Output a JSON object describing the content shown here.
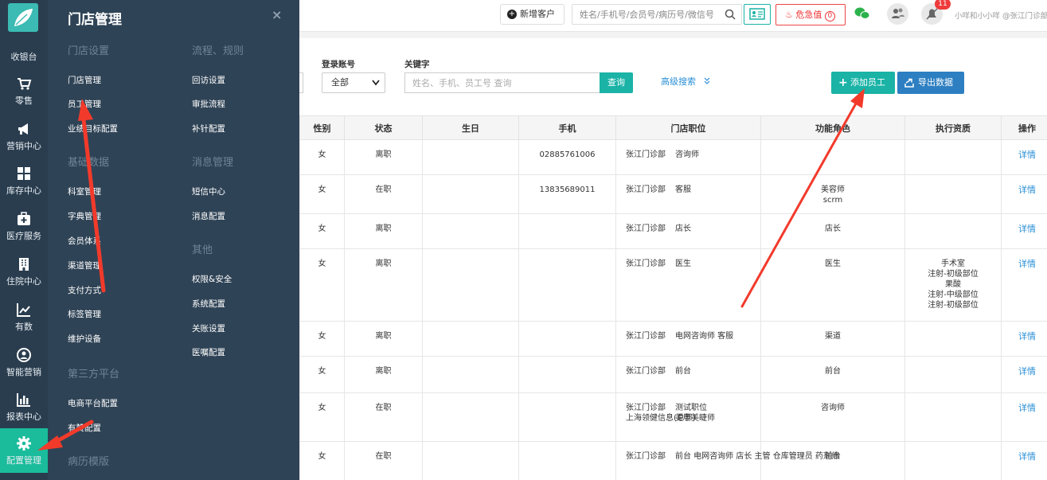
{
  "nav": {
    "cashier": "收银台",
    "items": [
      {
        "label": "零售",
        "icon": "cart-icon"
      },
      {
        "label": "营销中心",
        "icon": "megaphone-icon"
      },
      {
        "label": "库存中心",
        "icon": "grid-icon"
      },
      {
        "label": "医疗服务",
        "icon": "medical-kit-icon"
      },
      {
        "label": "住院中心",
        "icon": "building-icon"
      },
      {
        "label": "有数",
        "icon": "line-chart-icon"
      },
      {
        "label": "智能营销",
        "icon": "smart-icon"
      },
      {
        "label": "报表中心",
        "icon": "bar-chart-icon"
      },
      {
        "label": "配置管理",
        "icon": "gear-icon"
      }
    ]
  },
  "flyout": {
    "title": "门店管理",
    "close": "×",
    "col1": [
      {
        "section": "门店设置",
        "links": [
          "门店管理",
          "员工管理",
          "业绩目标配置"
        ]
      },
      {
        "section": "基础数据",
        "links": [
          "科室管理",
          "字典管理",
          "会员体系",
          "渠道管理",
          "支付方式",
          "标签管理",
          "维护设备"
        ]
      },
      {
        "section": "第三方平台",
        "links": [
          "电商平台配置",
          "有赞配置"
        ]
      },
      {
        "section": "病历模版",
        "links": []
      }
    ],
    "col2": [
      {
        "section": "流程、规则",
        "links": [
          "回访设置",
          "审批流程",
          "补针配置"
        ]
      },
      {
        "section": "消息管理",
        "links": [
          "短信中心",
          "消息配置"
        ]
      },
      {
        "section": "其他",
        "links": [
          "权限&安全",
          "系统配置",
          "关账设置",
          "医嘱配置"
        ]
      }
    ]
  },
  "topbar": {
    "new_customer": "新增客户",
    "search_placeholder": "姓名/手机号/会员号/病历号/微信号",
    "critical": "危急值",
    "critical_count": "0",
    "bell_badge": "11",
    "user": "小咩和小小咩 @张江门诊部"
  },
  "filters": {
    "login_label": "登录账号",
    "login_value": "全部",
    "keyword_label": "关键字",
    "keyword_placeholder": "姓名、手机、员工号 查询",
    "query": "查询",
    "advanced": "高级搜索",
    "add_staff": "添加员工",
    "export": "导出数据"
  },
  "table": {
    "headers": [
      "性别",
      "状态",
      "生日",
      "手机",
      "门店职位",
      "功能角色",
      "执行资质",
      "操作"
    ],
    "rows": [
      {
        "gender": "女",
        "status": "离职",
        "birthday": "",
        "phone": "02885761006",
        "positions": [
          [
            "张江门诊部",
            "咨询师"
          ]
        ],
        "roles": [],
        "quals": [],
        "action": "详情"
      },
      {
        "gender": "女",
        "status": "在职",
        "birthday": "",
        "phone": "13835689011",
        "positions": [
          [
            "张江门诊部",
            "客服"
          ]
        ],
        "roles": [
          "美容师",
          "scrm"
        ],
        "quals": [],
        "action": "详情"
      },
      {
        "gender": "女",
        "status": "离职",
        "birthday": "",
        "phone": "",
        "positions": [
          [
            "张江门诊部",
            "店长"
          ]
        ],
        "roles": [
          "店长"
        ],
        "quals": [],
        "action": "详情"
      },
      {
        "gender": "女",
        "status": "离职",
        "birthday": "",
        "phone": "",
        "positions": [
          [
            "张江门诊部",
            "医生"
          ]
        ],
        "roles": [
          "医生"
        ],
        "quals": [
          "手术室",
          "注射-初级部位",
          "果酸",
          "注射-中级部位",
          "注射-初级部位"
        ],
        "action": "详情"
      },
      {
        "gender": "女",
        "status": "离职",
        "birthday": "",
        "phone": "",
        "positions": [
          [
            "张江门诊部",
            "电网咨询师 客服"
          ]
        ],
        "roles": [
          "渠道"
        ],
        "quals": [],
        "action": "详情"
      },
      {
        "gender": "女",
        "status": "离职",
        "birthday": "",
        "phone": "",
        "positions": [
          [
            "张江门诊部",
            "前台"
          ]
        ],
        "roles": [
          "前台"
        ],
        "quals": [],
        "action": "详情"
      },
      {
        "gender": "女",
        "status": "在职",
        "birthday": "",
        "phone": "",
        "positions": [
          [
            "张江门诊部",
            "测试职位"
          ],
          [
            "上海领健信息(总部)",
            "美甲美睫师"
          ]
        ],
        "roles": [
          "咨询师"
        ],
        "quals": [],
        "action": "详情"
      },
      {
        "gender": "女",
        "status": "在职",
        "birthday": "",
        "phone": "",
        "positions": [
          [
            "张江门诊部",
            "前台 电网咨询师 店长 主管 仓库管理员 药剂师"
          ]
        ],
        "roles": [
          "前台"
        ],
        "quals": [],
        "action": "详情"
      }
    ]
  }
}
